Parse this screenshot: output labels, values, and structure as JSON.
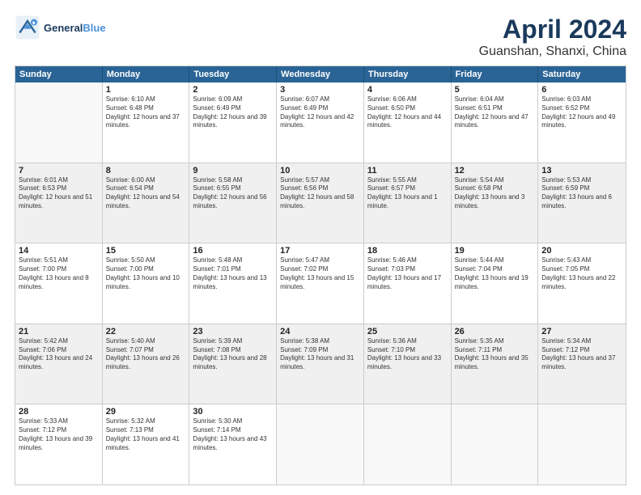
{
  "header": {
    "logo_line1": "General",
    "logo_line2": "Blue",
    "title": "April 2024",
    "subtitle": "Guanshan, Shanxi, China"
  },
  "calendar": {
    "days": [
      "Sunday",
      "Monday",
      "Tuesday",
      "Wednesday",
      "Thursday",
      "Friday",
      "Saturday"
    ],
    "rows": [
      [
        {
          "day": "",
          "empty": true
        },
        {
          "day": "1",
          "sunrise": "6:10 AM",
          "sunset": "6:48 PM",
          "daylight": "12 hours and 37 minutes."
        },
        {
          "day": "2",
          "sunrise": "6:09 AM",
          "sunset": "6:49 PM",
          "daylight": "12 hours and 39 minutes."
        },
        {
          "day": "3",
          "sunrise": "6:07 AM",
          "sunset": "6:49 PM",
          "daylight": "12 hours and 42 minutes."
        },
        {
          "day": "4",
          "sunrise": "6:06 AM",
          "sunset": "6:50 PM",
          "daylight": "12 hours and 44 minutes."
        },
        {
          "day": "5",
          "sunrise": "6:04 AM",
          "sunset": "6:51 PM",
          "daylight": "12 hours and 47 minutes."
        },
        {
          "day": "6",
          "sunrise": "6:03 AM",
          "sunset": "6:52 PM",
          "daylight": "12 hours and 49 minutes."
        }
      ],
      [
        {
          "day": "7",
          "sunrise": "6:01 AM",
          "sunset": "6:53 PM",
          "daylight": "12 hours and 51 minutes."
        },
        {
          "day": "8",
          "sunrise": "6:00 AM",
          "sunset": "6:54 PM",
          "daylight": "12 hours and 54 minutes."
        },
        {
          "day": "9",
          "sunrise": "5:58 AM",
          "sunset": "6:55 PM",
          "daylight": "12 hours and 56 minutes."
        },
        {
          "day": "10",
          "sunrise": "5:57 AM",
          "sunset": "6:56 PM",
          "daylight": "12 hours and 58 minutes."
        },
        {
          "day": "11",
          "sunrise": "5:55 AM",
          "sunset": "6:57 PM",
          "daylight": "13 hours and 1 minute."
        },
        {
          "day": "12",
          "sunrise": "5:54 AM",
          "sunset": "6:58 PM",
          "daylight": "13 hours and 3 minutes."
        },
        {
          "day": "13",
          "sunrise": "5:53 AM",
          "sunset": "6:59 PM",
          "daylight": "13 hours and 6 minutes."
        }
      ],
      [
        {
          "day": "14",
          "sunrise": "5:51 AM",
          "sunset": "7:00 PM",
          "daylight": "13 hours and 8 minutes."
        },
        {
          "day": "15",
          "sunrise": "5:50 AM",
          "sunset": "7:00 PM",
          "daylight": "13 hours and 10 minutes."
        },
        {
          "day": "16",
          "sunrise": "5:48 AM",
          "sunset": "7:01 PM",
          "daylight": "13 hours and 13 minutes."
        },
        {
          "day": "17",
          "sunrise": "5:47 AM",
          "sunset": "7:02 PM",
          "daylight": "13 hours and 15 minutes."
        },
        {
          "day": "18",
          "sunrise": "5:46 AM",
          "sunset": "7:03 PM",
          "daylight": "13 hours and 17 minutes."
        },
        {
          "day": "19",
          "sunrise": "5:44 AM",
          "sunset": "7:04 PM",
          "daylight": "13 hours and 19 minutes."
        },
        {
          "day": "20",
          "sunrise": "5:43 AM",
          "sunset": "7:05 PM",
          "daylight": "13 hours and 22 minutes."
        }
      ],
      [
        {
          "day": "21",
          "sunrise": "5:42 AM",
          "sunset": "7:06 PM",
          "daylight": "13 hours and 24 minutes."
        },
        {
          "day": "22",
          "sunrise": "5:40 AM",
          "sunset": "7:07 PM",
          "daylight": "13 hours and 26 minutes."
        },
        {
          "day": "23",
          "sunrise": "5:39 AM",
          "sunset": "7:08 PM",
          "daylight": "13 hours and 28 minutes."
        },
        {
          "day": "24",
          "sunrise": "5:38 AM",
          "sunset": "7:09 PM",
          "daylight": "13 hours and 31 minutes."
        },
        {
          "day": "25",
          "sunrise": "5:36 AM",
          "sunset": "7:10 PM",
          "daylight": "13 hours and 33 minutes."
        },
        {
          "day": "26",
          "sunrise": "5:35 AM",
          "sunset": "7:11 PM",
          "daylight": "13 hours and 35 minutes."
        },
        {
          "day": "27",
          "sunrise": "5:34 AM",
          "sunset": "7:12 PM",
          "daylight": "13 hours and 37 minutes."
        }
      ],
      [
        {
          "day": "28",
          "sunrise": "5:33 AM",
          "sunset": "7:12 PM",
          "daylight": "13 hours and 39 minutes."
        },
        {
          "day": "29",
          "sunrise": "5:32 AM",
          "sunset": "7:13 PM",
          "daylight": "13 hours and 41 minutes."
        },
        {
          "day": "30",
          "sunrise": "5:30 AM",
          "sunset": "7:14 PM",
          "daylight": "13 hours and 43 minutes."
        },
        {
          "day": "",
          "empty": true
        },
        {
          "day": "",
          "empty": true
        },
        {
          "day": "",
          "empty": true
        },
        {
          "day": "",
          "empty": true
        }
      ]
    ]
  }
}
